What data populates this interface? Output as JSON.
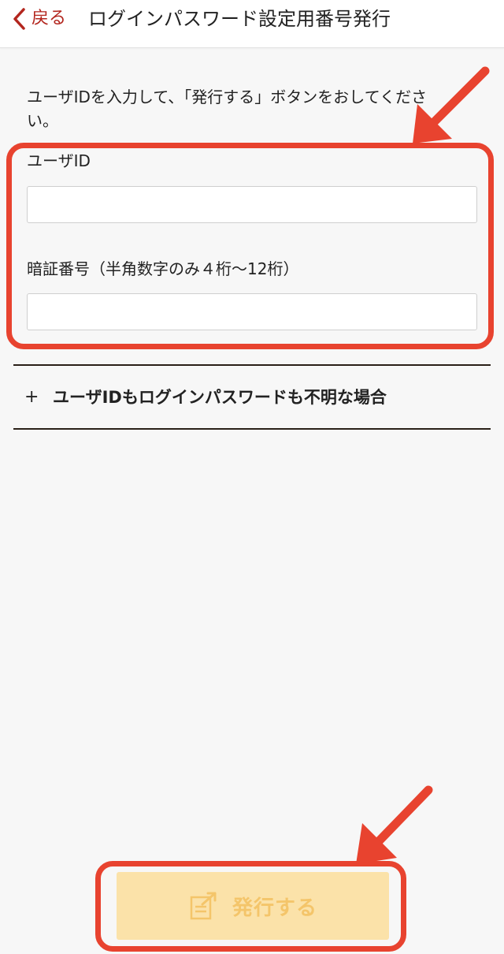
{
  "header": {
    "back_label": "戻る",
    "title": "ログインパスワード設定用番号発行"
  },
  "instructions": "ユーザIDを入力して、「発行する」ボタンをおしてください。",
  "form": {
    "user_id": {
      "label": "ユーザID",
      "value": "",
      "placeholder": ""
    },
    "pin": {
      "label": "暗証番号（半角数字のみ４桁～12桁）",
      "value": "",
      "placeholder": ""
    }
  },
  "accordion": {
    "icon": "plus-icon",
    "label": "ユーザIDもログインパスワードも不明な場合"
  },
  "submit": {
    "label": "発行する",
    "icon": "document-export-icon"
  },
  "colors": {
    "accent_red": "#b3261e",
    "annotation_red": "#e8432f",
    "button_bg": "#fbe2a9",
    "button_text": "#f4c56a"
  }
}
